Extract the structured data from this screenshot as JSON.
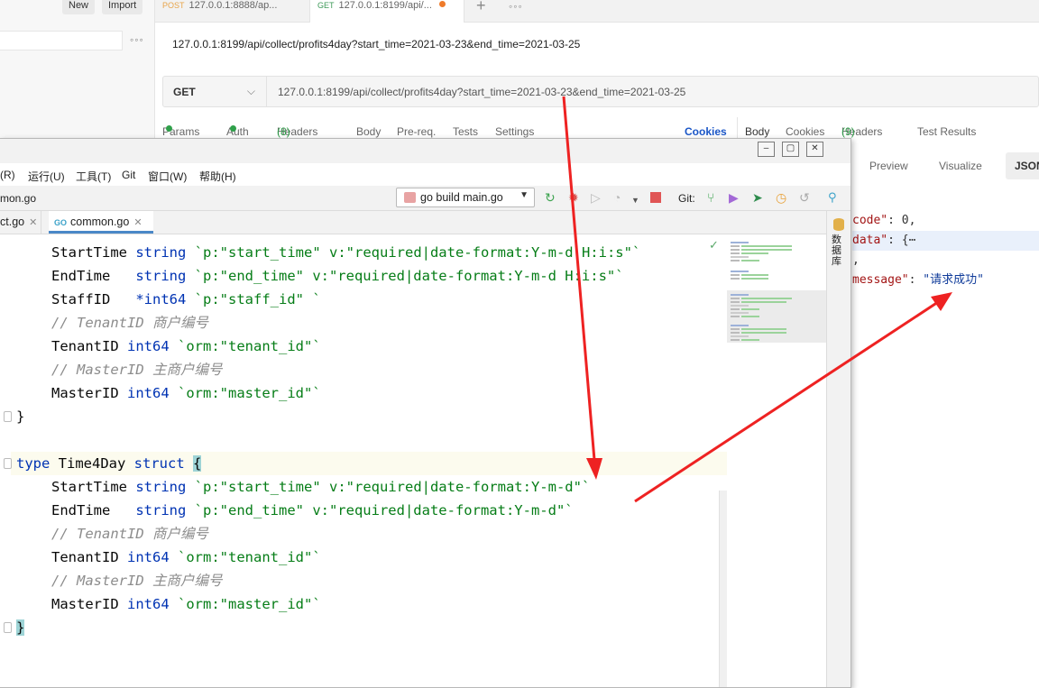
{
  "postman": {
    "sidebar": {
      "new_label": "New",
      "import_label": "Import",
      "more": "◦◦◦"
    },
    "tabs": [
      {
        "method": "POST",
        "label": "127.0.0.1:8888/ap..."
      },
      {
        "method": "GET",
        "label": "127.0.0.1:8199/api/..."
      }
    ],
    "new_tab": "+",
    "more_tabs": "◦◦◦",
    "request_title": "127.0.0.1:8199/api/collect/profits4day?start_time=2021-03-23&end_time=2021-03-25",
    "method": "GET",
    "url": "127.0.0.1:8199/api/collect/profits4day?start_time=2021-03-23&end_time=2021-03-25",
    "request_tabs": {
      "params": "Params",
      "auth": "Auth",
      "headers": "Headers",
      "headers_count": "(8)",
      "body": "Body",
      "prereq": "Pre-req.",
      "tests": "Tests",
      "settings": "Settings",
      "cookies": "Cookies"
    },
    "response_tabs": {
      "body": "Body",
      "cookies": "Cookies",
      "headers": "Headers",
      "headers_count": "(9)",
      "test_results": "Test Results"
    },
    "view_modes": {
      "preview": "Preview",
      "visualize": "Visualize",
      "json": "JSON"
    },
    "response_lines": [
      {
        "key": "code\"",
        "rest": ": 0,"
      },
      {
        "key": "data\"",
        "rest": ": {⋯"
      },
      {
        "key": "",
        "rest": ","
      },
      {
        "key": "message\"",
        "rest": ": ",
        "value": "\"请求成功\""
      }
    ]
  },
  "ide": {
    "window_buttons": [
      "–",
      "▢",
      "✕"
    ],
    "menu": [
      "(R)",
      "运行(U)",
      "工具(T)",
      "Git",
      "窗口(W)",
      "帮助(H)"
    ],
    "breadcrumb": "mon.go",
    "run_config": "go build main.go",
    "git_label": "Git:",
    "file_tabs": [
      {
        "label": "ct.go",
        "active": false
      },
      {
        "label": "common.go",
        "active": true
      }
    ],
    "go_badge": "GO",
    "side_panel_label": "数据库",
    "code": {
      "l1_field": "StartTime",
      "l1_type": "string",
      "l1_tag": "`p:\"start_time\" v:\"required|date-format:Y-m-d H:i:s\"`",
      "l2_field": "EndTime",
      "l2_type": "string",
      "l2_tag": "`p:\"end_time\" v:\"required|date-format:Y-m-d H:i:s\"`",
      "l3_field": "StaffID",
      "l3_type": "*int64",
      "l3_tag": "`p:\"staff_id\" `",
      "l4_comment": "// TenantID 商户编号",
      "l5_field": "TenantID",
      "l5_type": "int64",
      "l5_tag": "`orm:\"tenant_id\"`",
      "l6_comment": "// MasterID 主商户编号",
      "l7_field": "MasterID",
      "l7_type": "int64",
      "l7_tag": "`orm:\"master_id\"`",
      "l8_close": "}",
      "l9_type_kw": "type",
      "l9_name": "Time4Day",
      "l9_struct_kw": "struct",
      "l9_brace": "{",
      "l10_field": "StartTime",
      "l10_type": "string",
      "l10_tag": "`p:\"start_time\" v:\"required|date-format:Y-m-d\"`",
      "l11_field": "EndTime",
      "l11_type": "string",
      "l11_tag": "`p:\"end_time\" v:\"required|date-format:Y-m-d\"`",
      "l12_comment": "// TenantID 商户编号",
      "l13_field": "TenantID",
      "l13_type": "int64",
      "l13_tag": "`orm:\"tenant_id\"`",
      "l14_comment": "// MasterID 主商户编号",
      "l15_field": "MasterID",
      "l15_type": "int64",
      "l15_tag": "`orm:\"master_id\"`",
      "l16_close": "}"
    }
  },
  "colors": {
    "annotation_arrow": "#ee2222",
    "keyword": "#0033b3",
    "string": "#067d17",
    "comment": "#8c8c8c",
    "postman_green": "#2fa04a",
    "cookies_active": "#1a56c7"
  }
}
